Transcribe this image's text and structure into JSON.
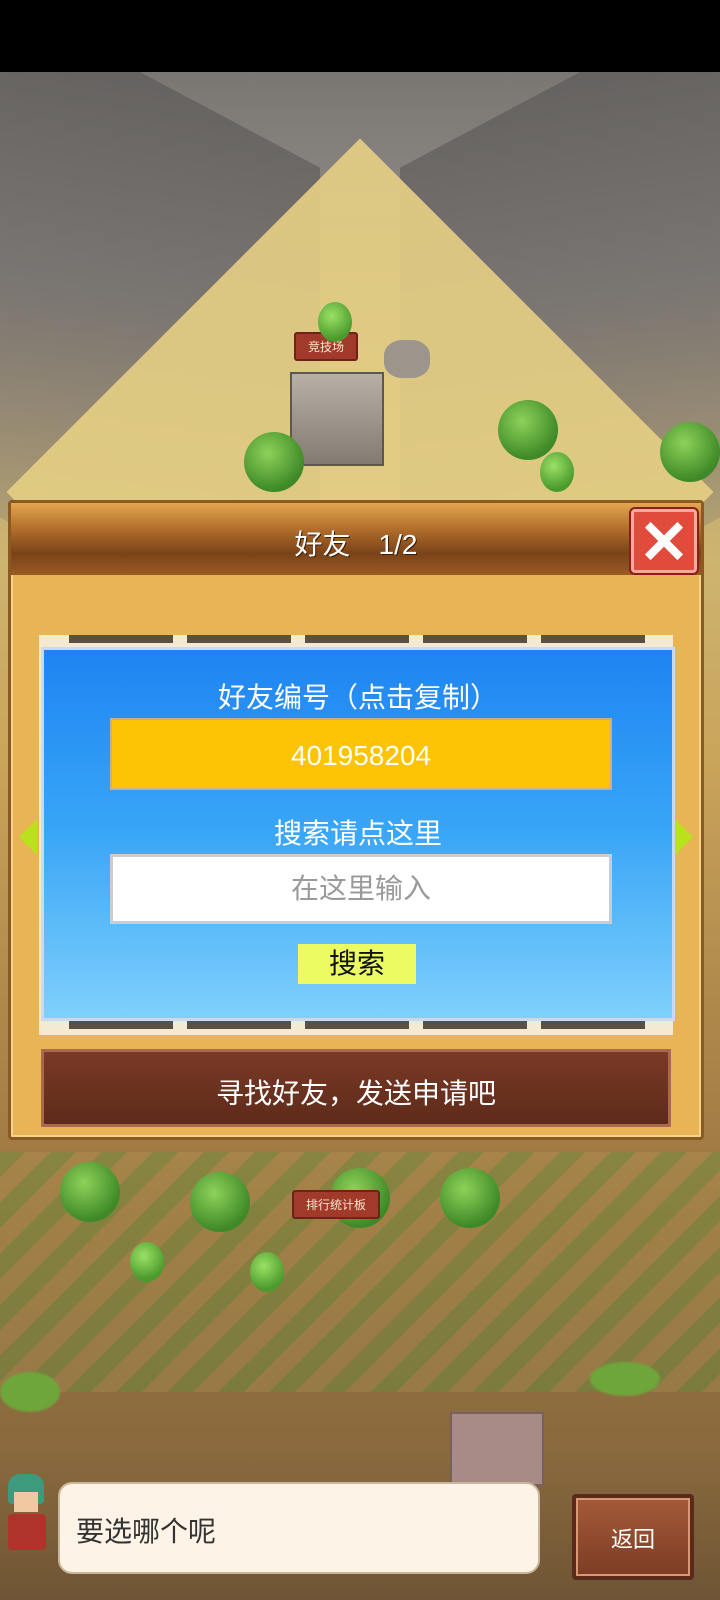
{
  "map": {
    "arena_label": "竞技场",
    "ranking_label": "排行统计板"
  },
  "dialog": {
    "title": "好友　1/2",
    "friend_id_label": "好友编号（点击复制）",
    "friend_id_value": "401958204",
    "search_label": "搜索请点这里",
    "search_placeholder": "在这里输入",
    "search_button": "搜索",
    "banner_text": "寻找好友，发送申请吧"
  },
  "bottom": {
    "speech_text": "要选哪个呢",
    "return_button": "返回"
  },
  "icons": {
    "close": "close-icon",
    "left": "arrow-left-icon",
    "right": "arrow-right-icon"
  },
  "colors": {
    "dialog_bg": "#e8b455",
    "panel_blue": "#1e84f2",
    "id_box": "#fdc305",
    "search_button": "#ecfb62",
    "close_red": "#e04b3c"
  }
}
